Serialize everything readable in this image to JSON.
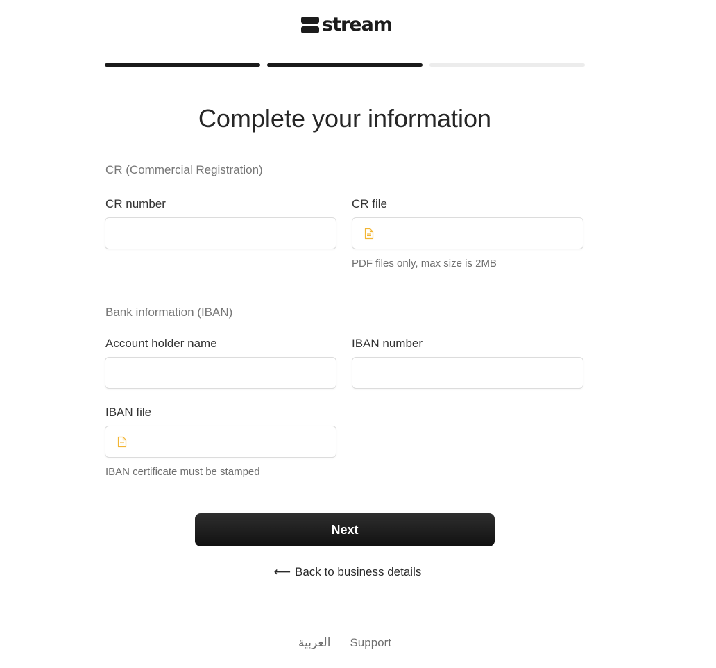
{
  "brand": {
    "name": "stream"
  },
  "progress": {
    "total_steps": 3,
    "completed_steps": 2
  },
  "title": "Complete your information",
  "cr_section": {
    "heading": "CR (Commercial Registration)",
    "cr_number": {
      "label": "CR number",
      "value": "",
      "placeholder": ""
    },
    "cr_file": {
      "label": "CR file",
      "helper": "PDF files only, max size is 2MB",
      "icon": "document-icon"
    }
  },
  "bank_section": {
    "heading": "Bank information (IBAN)",
    "account_holder": {
      "label": "Account holder name",
      "value": "",
      "placeholder": ""
    },
    "iban_number": {
      "label": "IBAN number",
      "value": "",
      "placeholder": ""
    },
    "iban_file": {
      "label": "IBAN file",
      "helper": "IBAN certificate must be stamped",
      "icon": "document-icon"
    }
  },
  "actions": {
    "next_label": "Next",
    "back_label": "Back to business details",
    "back_icon": "arrow-left-icon"
  },
  "footer": {
    "language": "العربية",
    "support": "Support"
  },
  "colors": {
    "primary": "#1a1a1a",
    "file_icon": "#f2b534",
    "progress_inactive": "#ececec"
  }
}
